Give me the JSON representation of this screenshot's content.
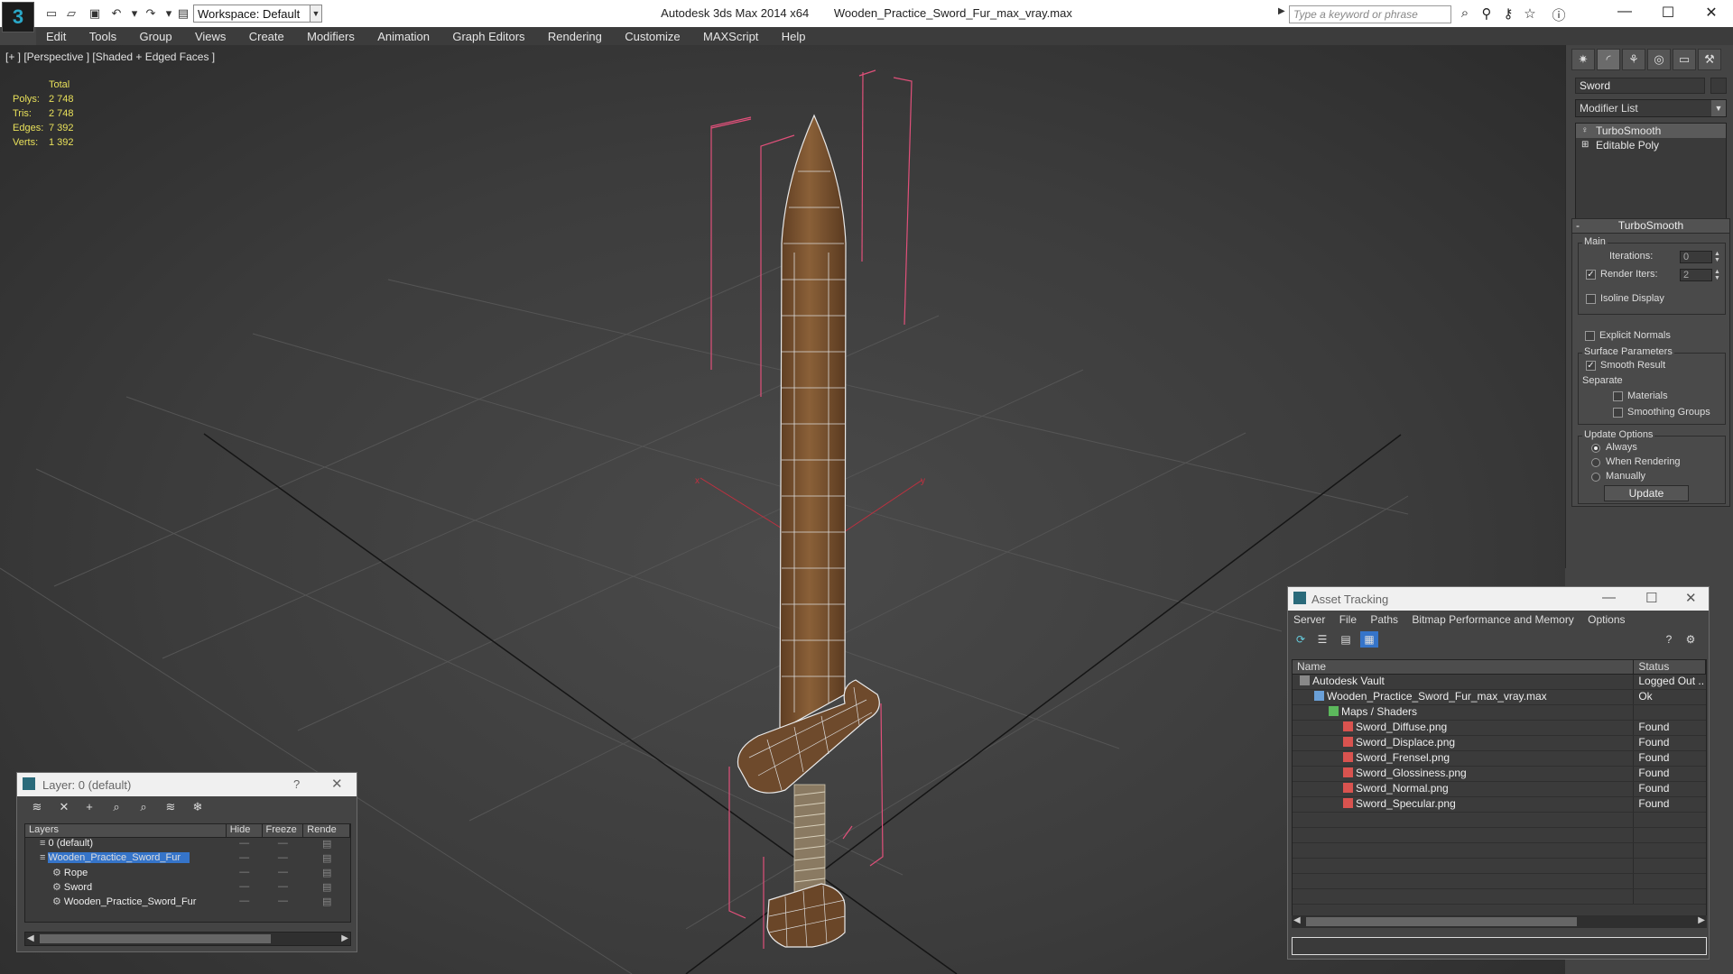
{
  "titlebar": {
    "app_logo": "3",
    "workspace": "Workspace: Default",
    "app_name": "Autodesk 3ds Max  2014 x64",
    "file_name": "Wooden_Practice_Sword_Fur_max_vray.max",
    "search_placeholder": "Type a keyword or phrase"
  },
  "menu": [
    "Edit",
    "Tools",
    "Group",
    "Views",
    "Create",
    "Modifiers",
    "Animation",
    "Graph Editors",
    "Rendering",
    "Customize",
    "MAXScript",
    "Help"
  ],
  "viewport": {
    "label": "[+ ] [Perspective ] [Shaded + Edged Faces ]",
    "stats": {
      "header": "Total",
      "rows": [
        {
          "k": "Polys:",
          "v": "2 748"
        },
        {
          "k": "Tris:",
          "v": "2 748"
        },
        {
          "k": "Edges:",
          "v": "7 392"
        },
        {
          "k": "Verts:",
          "v": "1 392"
        }
      ]
    },
    "axis_x": "x",
    "axis_y": "y"
  },
  "command_panel": {
    "object_name": "Sword",
    "modifier_list": "Modifier List",
    "stack": [
      "TurboSmooth",
      "Editable Poly"
    ],
    "rollout_title": "TurboSmooth",
    "main_group": "Main",
    "iterations_label": "Iterations:",
    "iterations_value": "0",
    "render_iters_label": "Render Iters:",
    "render_iters_value": "2",
    "isoline": "Isoline Display",
    "explicit_normals": "Explicit Normals",
    "surface_group": "Surface Parameters",
    "smooth_result": "Smooth Result",
    "separate": "Separate",
    "materials": "Materials",
    "smoothing_groups": "Smoothing Groups",
    "update_group": "Update Options",
    "always": "Always",
    "when_rendering": "When Rendering",
    "manually": "Manually",
    "update_button": "Update"
  },
  "asset_tracking": {
    "title": "Asset Tracking",
    "menu": [
      "Server",
      "File",
      "Paths",
      "Bitmap Performance and Memory",
      "Options"
    ],
    "col_name": "Name",
    "col_status": "Status",
    "rows": [
      {
        "name": "Autodesk Vault",
        "status": "Logged Out ..",
        "indent": 0
      },
      {
        "name": "Wooden_Practice_Sword_Fur_max_vray.max",
        "status": "Ok",
        "indent": 1
      },
      {
        "name": "Maps / Shaders",
        "status": "",
        "indent": 2
      },
      {
        "name": "Sword_Diffuse.png",
        "status": "Found",
        "indent": 3
      },
      {
        "name": "Sword_Displace.png",
        "status": "Found",
        "indent": 3
      },
      {
        "name": "Sword_Frensel.png",
        "status": "Found",
        "indent": 3
      },
      {
        "name": "Sword_Glossiness.png",
        "status": "Found",
        "indent": 3
      },
      {
        "name": "Sword_Normal.png",
        "status": "Found",
        "indent": 3
      },
      {
        "name": "Sword_Specular.png",
        "status": "Found",
        "indent": 3
      }
    ]
  },
  "layer_window": {
    "title": "Layer: 0 (default)",
    "help": "?",
    "col_layers": "Layers",
    "col_hide": "Hide",
    "col_freeze": "Freeze",
    "col_render": "Rende",
    "rows": [
      {
        "name": "0 (default)",
        "indent": 0,
        "selected": false
      },
      {
        "name": "Wooden_Practice_Sword_Fur",
        "indent": 0,
        "selected": true
      },
      {
        "name": "Rope",
        "indent": 1,
        "selected": false
      },
      {
        "name": "Sword",
        "indent": 1,
        "selected": false
      },
      {
        "name": "Wooden_Practice_Sword_Fur",
        "indent": 1,
        "selected": false
      }
    ]
  },
  "colors": {
    "bbox": "#e0507a",
    "wood": "#7a5432",
    "stats": "#e8e05a",
    "selection": "#3574c9"
  }
}
